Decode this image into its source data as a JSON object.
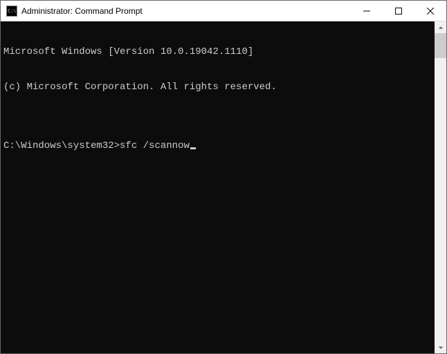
{
  "window": {
    "title": "Administrator: Command Prompt",
    "icon_glyph": "C:\\."
  },
  "terminal": {
    "lines": [
      "Microsoft Windows [Version 10.0.19042.1110]",
      "(c) Microsoft Corporation. All rights reserved.",
      ""
    ],
    "prompt": "C:\\Windows\\system32>",
    "command": "sfc /scannow"
  }
}
